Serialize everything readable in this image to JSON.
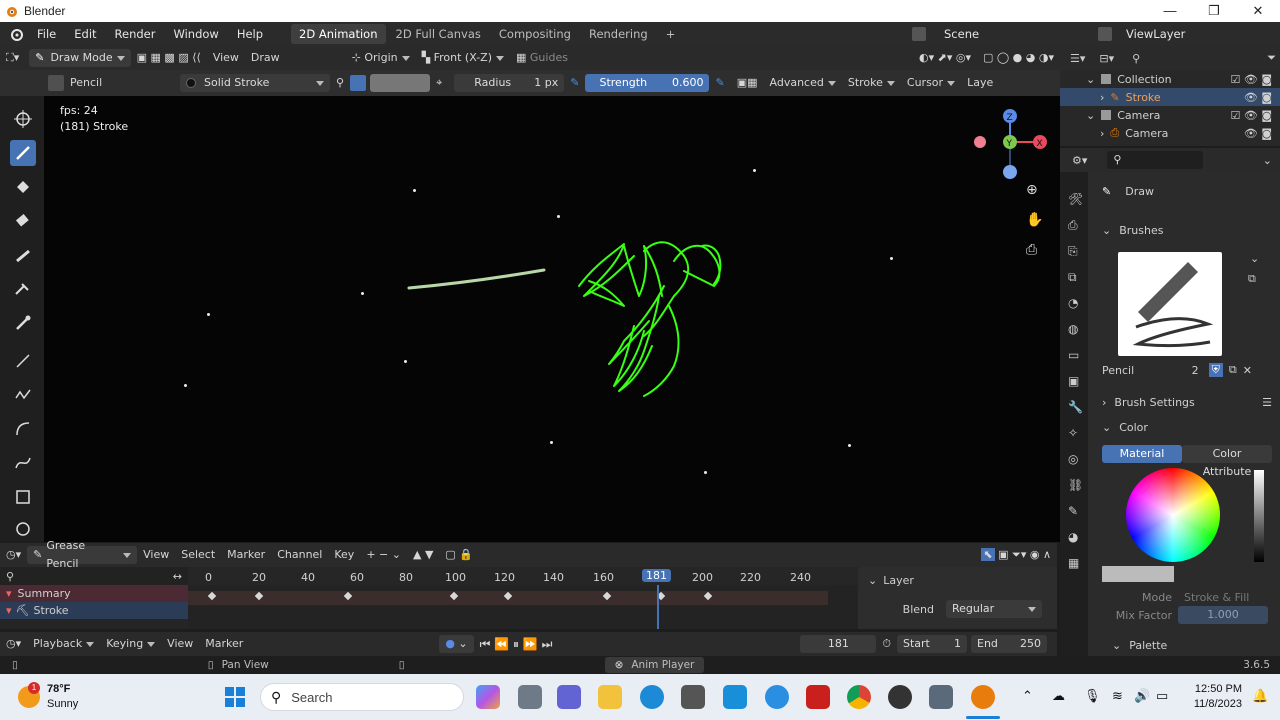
{
  "window": {
    "title": "Blender"
  },
  "menu": {
    "items": [
      "File",
      "Edit",
      "Render",
      "Window",
      "Help"
    ],
    "workspaces": [
      "2D Animation",
      "2D Full Canvas",
      "Compositing",
      "Rendering"
    ],
    "add_tab": "+",
    "scene": "Scene",
    "view_layer": "ViewLayer"
  },
  "header": {
    "mode": "Draw Mode",
    "view": "View",
    "draw": "Draw",
    "origin": "Origin",
    "plane": "Front (X-Z)",
    "guides": "Guides"
  },
  "tool_settings": {
    "brush": "Pencil",
    "material": "Solid Stroke",
    "radius_label": "Radius",
    "radius_value": "1 px",
    "strength_label": "Strength",
    "strength_value": "0.600",
    "advanced": "Advanced",
    "stroke": "Stroke",
    "cursor": "Cursor",
    "layer": "Laye"
  },
  "viewport": {
    "fps": "fps: 24",
    "info": "(181) Stroke",
    "gizmo": {
      "z": "Z",
      "y": "Y",
      "x": "X"
    }
  },
  "outliner": {
    "rows": [
      {
        "label": "Collection"
      },
      {
        "label": "Stroke"
      },
      {
        "label": "Camera"
      },
      {
        "label": "Camera"
      }
    ]
  },
  "properties": {
    "tool": "Draw",
    "brushes": "Brushes",
    "brush_name": "Pencil",
    "brush_users": "2",
    "brush_settings": "Brush Settings",
    "color": "Color",
    "material_tab": "Material",
    "color_attr_tab": "Color Attribute",
    "mode_label": "Mode",
    "mode_value": "Stroke & Fill",
    "mix_label": "Mix Factor",
    "mix_value": "1.000",
    "palette": "Palette"
  },
  "timeline": {
    "editor": "Grease Pencil",
    "menus": [
      "View",
      "Select",
      "Marker",
      "Channel",
      "Key"
    ],
    "ticks": [
      "0",
      "20",
      "40",
      "60",
      "80",
      "100",
      "120",
      "140",
      "160",
      "181",
      "200",
      "220",
      "240"
    ],
    "channels": [
      "Summary",
      "Stroke"
    ],
    "side_layer": "Layer",
    "blend_label": "Blend",
    "blend_value": "Regular"
  },
  "playback": {
    "menus": [
      "Playback",
      "Keying",
      "View",
      "Marker"
    ],
    "current_frame": "181",
    "start_label": "Start",
    "start_value": "1",
    "end_label": "End",
    "end_value": "250"
  },
  "statusbar": {
    "pan": "Pan View",
    "anim": "Anim Player",
    "version": "3.6.5"
  },
  "taskbar": {
    "weather_temp": "78°F",
    "weather_text": "Sunny",
    "search": "Search",
    "time": "12:50 PM",
    "date": "11/8/2023",
    "weather_badge": "1"
  },
  "colors": {
    "accent": "#4772b3",
    "stroke_green": "#39ff14",
    "viewport_bg": "#050505",
    "current_frame": "#4772b3"
  }
}
